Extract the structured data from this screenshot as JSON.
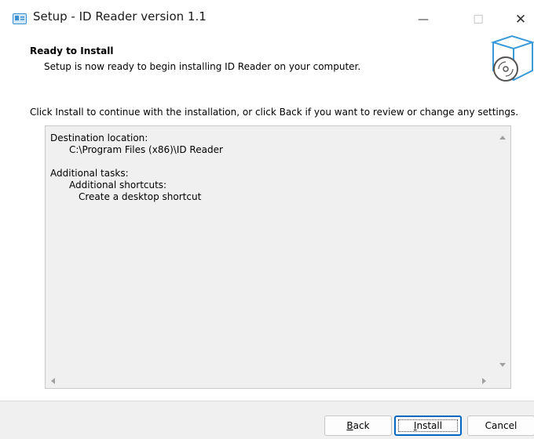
{
  "window": {
    "title": "Setup - ID Reader version 1.1",
    "controls": {
      "minimize": "—",
      "maximize": "☐",
      "close": "✕"
    }
  },
  "header": {
    "title": "Ready to Install",
    "subtitle": "Setup is now ready to begin installing ID Reader on your computer."
  },
  "instruction": "Click Install to continue with the installation, or click Back if you want to review or change any settings.",
  "memo": {
    "destination_label": "Destination location:",
    "destination_path": "C:\\Program Files (x86)\\ID Reader",
    "tasks_label": "Additional tasks:",
    "shortcuts_label": "Additional shortcuts:",
    "shortcut_item": "Create a desktop shortcut"
  },
  "buttons": {
    "back_hotkey": "B",
    "back_rest": "ack",
    "install_hotkey": "I",
    "install_rest": "nstall",
    "cancel": "Cancel"
  },
  "colors": {
    "accent": "#0067c0",
    "panel": "#f0f0f0",
    "icon": "#3a9ad9"
  },
  "icons": {
    "app": "setup-app-icon",
    "wizard": "install-box-disc-icon"
  }
}
